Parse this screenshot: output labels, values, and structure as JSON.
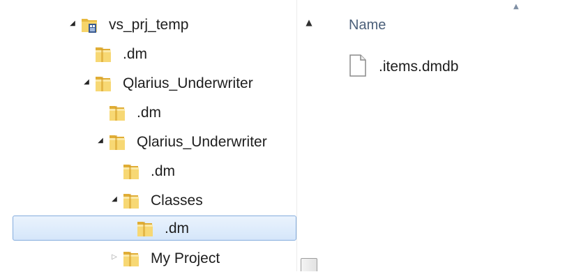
{
  "window_title": "vs_prj_temp",
  "navigation_tree": {
    "items": [
      {
        "label": "vs_prj_temp",
        "expander": "expanded",
        "icon": "project-folder-icon"
      },
      {
        "label": ".dm",
        "expander": "none",
        "icon": "folder-icon"
      },
      {
        "label": "Qlarius_Underwriter",
        "expander": "expanded",
        "icon": "folder-icon"
      },
      {
        "label": ".dm",
        "expander": "none",
        "icon": "folder-icon"
      },
      {
        "label": "Qlarius_Underwriter",
        "expander": "expanded",
        "icon": "folder-icon"
      },
      {
        "label": ".dm",
        "expander": "none",
        "icon": "folder-icon"
      },
      {
        "label": "Classes",
        "expander": "expanded",
        "icon": "folder-icon"
      },
      {
        "label": ".dm",
        "expander": "none",
        "icon": "folder-icon",
        "selected": true
      },
      {
        "label": "My Project",
        "expander": "collapsed",
        "icon": "folder-icon"
      }
    ]
  },
  "scrollbar": {
    "up_arrow_icon": "scroll-up-arrow-icon"
  },
  "content_pane": {
    "column_header": "Name",
    "sort_indicator_icon": "sort-ascending-icon",
    "files": [
      {
        "name": ".items.dmdb",
        "icon": "file-icon"
      }
    ]
  },
  "colors": {
    "selection_border": "#84acdd",
    "selection_fill": "#dbe9fb",
    "folder_yellow": "#f2cc53",
    "header_text": "#4c607a"
  }
}
